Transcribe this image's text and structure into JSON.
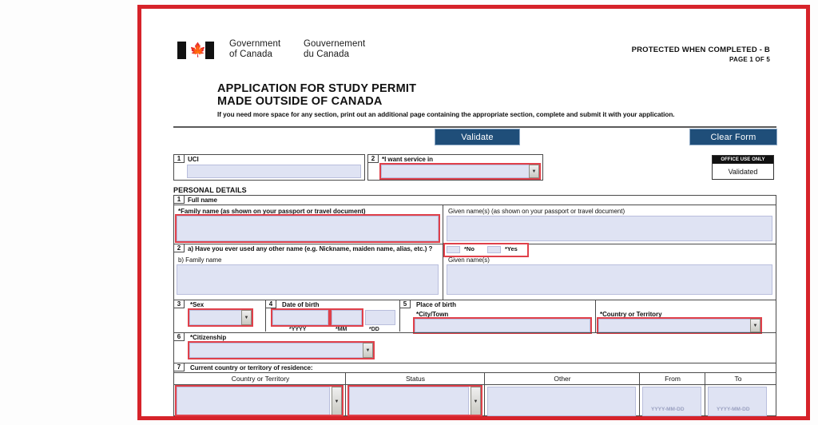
{
  "document": {
    "protected_notice": "PROTECTED WHEN COMPLETED - B",
    "page_indicator": "PAGE 1 OF 5",
    "title_line1": "APPLICATION FOR STUDY PERMIT",
    "title_line2": "MADE OUTSIDE OF CANADA",
    "subnote": "If you need more space for any section, print out an additional page containing the appropriate section, complete and submit it with your application.",
    "wordmark_en_line1": "Government",
    "wordmark_en_line2": "of Canada",
    "wordmark_fr_line1": "Gouvernement",
    "wordmark_fr_line2": "du Canada",
    "flag_icon": "canada-flag-icon"
  },
  "toolbar": {
    "validate_label": "Validate",
    "clear_label": "Clear Form",
    "accent_color": "#1f4e79"
  },
  "office_use": {
    "caption": "OFFICE USE ONLY",
    "status": "Validated"
  },
  "top_fields": {
    "uci": {
      "number": "1",
      "label": "UCI",
      "value": ""
    },
    "service": {
      "number": "2",
      "label": "*I want service in",
      "value": "",
      "dropdown_icon": "chevron-down-icon"
    }
  },
  "personal_details": {
    "section_title": "PERSONAL DETAILS",
    "full_name": {
      "number": "1",
      "heading": "Full name",
      "family_label": "*Family name (as shown on your passport or travel document)",
      "family_value": "",
      "given_label": "Given name(s) (as shown on your passport or travel document)",
      "given_value": ""
    },
    "other_name": {
      "number": "2",
      "question": "a) Have you ever used any other name (e.g. Nickname, maiden name, alias, etc.) ?",
      "option_no": "*No",
      "option_yes": "*Yes",
      "family_label": "b) Family name",
      "family_value": "",
      "given_label": "Given name(s)",
      "given_value": ""
    },
    "sex": {
      "number": "3",
      "label": "*Sex",
      "value": "",
      "dropdown_icon": "chevron-down-icon"
    },
    "date_of_birth": {
      "number": "4",
      "label": "Date of birth",
      "yyyy_label": "*YYYY",
      "mm_label": "*MM",
      "dd_label": "*DD",
      "yyyy_value": "",
      "mm_value": "",
      "dd_value": ""
    },
    "place_of_birth": {
      "number": "5",
      "label": "Place of birth",
      "city_label": "*City/Town",
      "city_value": "",
      "country_label": "*Country or Territory",
      "country_value": "",
      "dropdown_icon": "chevron-down-icon"
    },
    "citizenship": {
      "number": "6",
      "label": "*Citizenship",
      "value": "",
      "dropdown_icon": "chevron-down-icon"
    },
    "residence": {
      "number": "7",
      "label": "Current country or territory of residence:",
      "columns": [
        "Country or Territory",
        "Status",
        "Other",
        "From",
        "To"
      ],
      "row": {
        "country": "",
        "status": "",
        "other": "",
        "from": "",
        "to": "",
        "from_hint": "YYYY-MM-DD",
        "to_hint": "YYYY-MM-DD"
      },
      "dropdown_icon": "chevron-down-icon"
    }
  },
  "colors": {
    "field_fill": "#dfe3f3",
    "highlight_red": "#e0404a",
    "frame_red": "#d6232a"
  }
}
